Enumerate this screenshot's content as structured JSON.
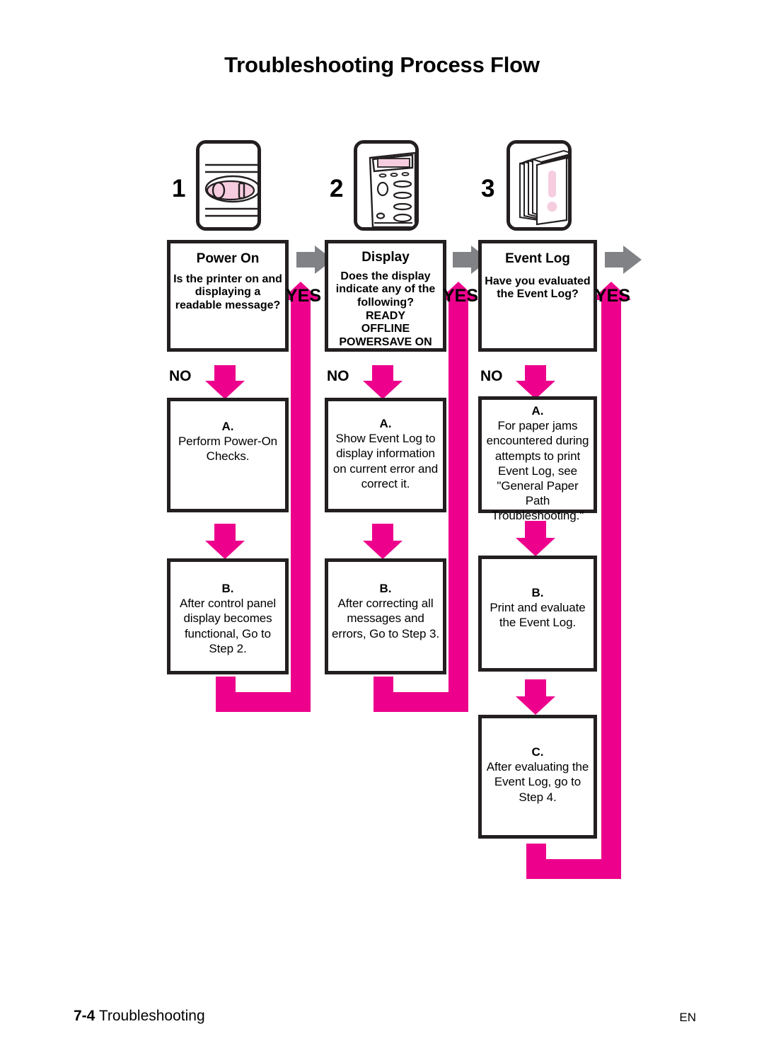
{
  "page": {
    "title": "Troubleshooting Process Flow",
    "footer_page_number": "7-4",
    "footer_section": "Troubleshooting",
    "footer_language": "EN"
  },
  "colors": {
    "magenta": "#EC008C",
    "gray_arrow": "#808285",
    "outline": "#231f20",
    "pink_fill": "#F6CDDF"
  },
  "steps": [
    {
      "number": "1",
      "icon": "power-switch-icon",
      "title": "Power On",
      "question": "Is the printer on and displaying a readable message?",
      "yes_label": "YES",
      "no_label": "NO",
      "actions": [
        {
          "label": "A.",
          "text": "Perform Power-On Checks."
        },
        {
          "label": "B.",
          "text": "After control panel display becomes functional, Go to Step 2."
        }
      ]
    },
    {
      "number": "2",
      "icon": "control-panel-icon",
      "title": "Display",
      "question": "Does the display indicate any of the following?",
      "options": [
        "READY",
        "OFFLINE",
        "POWERSAVE ON"
      ],
      "yes_label": "YES",
      "no_label": "NO",
      "actions": [
        {
          "label": "A.",
          "text": "Show Event Log to display information on current error and correct it."
        },
        {
          "label": "B.",
          "text": "After correcting all messages and errors, Go to Step 3."
        }
      ]
    },
    {
      "number": "3",
      "icon": "event-log-pages-icon",
      "title": "Event Log",
      "question": "Have you evaluated the Event Log?",
      "yes_label": "YES",
      "no_label": "NO",
      "actions": [
        {
          "label": "A.",
          "text": "For paper jams encountered during attempts to print Event Log, see \"General Paper Path Troubleshooting.\""
        },
        {
          "label": "B.",
          "text": "Print and evaluate the Event Log."
        },
        {
          "label": "C.",
          "text": "After evaluating the Event Log, go to Step 4."
        }
      ]
    }
  ]
}
